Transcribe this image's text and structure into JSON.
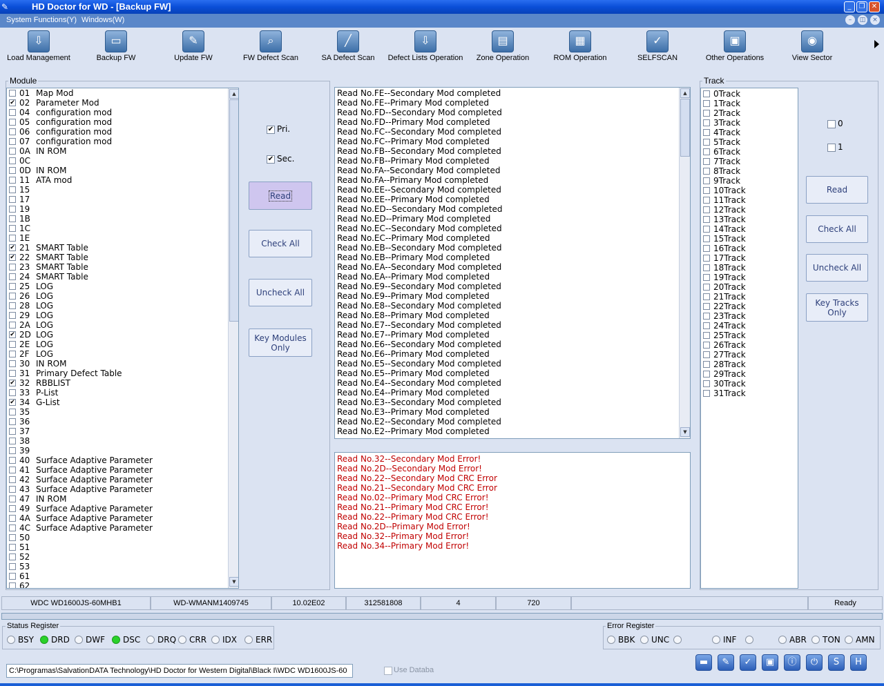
{
  "window": {
    "title": "HD Doctor for WD - [Backup FW]"
  },
  "menu": {
    "items": [
      "System Functions(Y)",
      "Windows(W)"
    ]
  },
  "toolbar": {
    "buttons": [
      {
        "label": "Load Management",
        "icon": "load-management-icon"
      },
      {
        "label": "Backup FW",
        "icon": "floppy-icon"
      },
      {
        "label": "Update FW",
        "icon": "update-icon"
      },
      {
        "label": "FW Defect Scan",
        "icon": "magnifier-icon"
      },
      {
        "label": "SA Defect Scan",
        "icon": "wand-icon"
      },
      {
        "label": "Defect Lists Operation",
        "icon": "defect-list-icon"
      },
      {
        "label": "Zone Operation",
        "icon": "zone-icon"
      },
      {
        "label": "ROM Operation",
        "icon": "chip-icon"
      },
      {
        "label": "SELFSCAN",
        "icon": "checkmark-icon"
      },
      {
        "label": "Other Operations",
        "icon": "document-icon"
      },
      {
        "label": "View Sector",
        "icon": "disk-icon"
      }
    ]
  },
  "module": {
    "title": "Module",
    "items": [
      {
        "code": "01",
        "name": "Map Mod",
        "checked": false
      },
      {
        "code": "02",
        "name": "Parameter Mod",
        "checked": true
      },
      {
        "code": "04",
        "name": "configuration mod",
        "checked": false
      },
      {
        "code": "05",
        "name": "configuration mod",
        "checked": false
      },
      {
        "code": "06",
        "name": "configuration mod",
        "checked": false
      },
      {
        "code": "07",
        "name": "configuration mod",
        "checked": false
      },
      {
        "code": "0A",
        "name": "IN ROM",
        "checked": false
      },
      {
        "code": "0C",
        "name": "",
        "checked": false
      },
      {
        "code": "0D",
        "name": "IN ROM",
        "checked": false
      },
      {
        "code": "11",
        "name": "ATA mod",
        "checked": false
      },
      {
        "code": "15",
        "name": "",
        "checked": false
      },
      {
        "code": "17",
        "name": "",
        "checked": false
      },
      {
        "code": "19",
        "name": "",
        "checked": false
      },
      {
        "code": "1B",
        "name": "",
        "checked": false
      },
      {
        "code": "1C",
        "name": "",
        "checked": false
      },
      {
        "code": "1E",
        "name": "",
        "checked": false
      },
      {
        "code": "21",
        "name": "SMART Table",
        "checked": true
      },
      {
        "code": "22",
        "name": "SMART Table",
        "checked": true
      },
      {
        "code": "23",
        "name": "SMART Table",
        "checked": false
      },
      {
        "code": "24",
        "name": "SMART Table",
        "checked": false
      },
      {
        "code": "25",
        "name": "LOG",
        "checked": false
      },
      {
        "code": "26",
        "name": "LOG",
        "checked": false
      },
      {
        "code": "28",
        "name": "LOG",
        "checked": false
      },
      {
        "code": "29",
        "name": "LOG",
        "checked": false
      },
      {
        "code": "2A",
        "name": "LOG",
        "checked": false
      },
      {
        "code": "2D",
        "name": "LOG",
        "checked": true
      },
      {
        "code": "2E",
        "name": "LOG",
        "checked": false
      },
      {
        "code": "2F",
        "name": "LOG",
        "checked": false
      },
      {
        "code": "30",
        "name": "IN ROM",
        "checked": false
      },
      {
        "code": "31",
        "name": "Primary Defect Table",
        "checked": false
      },
      {
        "code": "32",
        "name": "RBBLIST",
        "checked": true
      },
      {
        "code": "33",
        "name": "P-List",
        "checked": false
      },
      {
        "code": "34",
        "name": "G-List",
        "checked": true
      },
      {
        "code": "35",
        "name": "",
        "checked": false
      },
      {
        "code": "36",
        "name": "",
        "checked": false
      },
      {
        "code": "37",
        "name": "",
        "checked": false
      },
      {
        "code": "38",
        "name": "",
        "checked": false
      },
      {
        "code": "39",
        "name": "",
        "checked": false
      },
      {
        "code": "40",
        "name": "Surface Adaptive Parameter",
        "checked": false
      },
      {
        "code": "41",
        "name": "Surface Adaptive Parameter",
        "checked": false
      },
      {
        "code": "42",
        "name": "Surface Adaptive Parameter",
        "checked": false
      },
      {
        "code": "43",
        "name": "Surface Adaptive Parameter",
        "checked": false
      },
      {
        "code": "47",
        "name": "IN ROM",
        "checked": false
      },
      {
        "code": "49",
        "name": "Surface Adaptive Parameter",
        "checked": false
      },
      {
        "code": "4A",
        "name": "Surface Adaptive Parameter",
        "checked": false
      },
      {
        "code": "4C",
        "name": "Surface Adaptive Parameter",
        "checked": false
      },
      {
        "code": "50",
        "name": "",
        "checked": false
      },
      {
        "code": "51",
        "name": "",
        "checked": false
      },
      {
        "code": "52",
        "name": "",
        "checked": false
      },
      {
        "code": "53",
        "name": "",
        "checked": false
      },
      {
        "code": "61",
        "name": "",
        "checked": false
      },
      {
        "code": "62",
        "name": "",
        "checked": false
      }
    ]
  },
  "controls": {
    "pri_label": "Pri.",
    "pri_checked": true,
    "sec_label": "Sec.",
    "sec_checked": true,
    "read_label": "Read",
    "check_all_label": "Check All",
    "uncheck_all_label": "Uncheck All",
    "key_modules_label": "Key Modules Only"
  },
  "log": {
    "lines": [
      "Read No.FE--Secondary Mod completed",
      "Read No.FE--Primary Mod completed",
      "Read No.FD--Secondary Mod completed",
      "Read No.FD--Primary Mod completed",
      "Read No.FC--Secondary Mod completed",
      "Read No.FC--Primary Mod completed",
      "Read No.FB--Secondary Mod completed",
      "Read No.FB--Primary Mod completed",
      "Read No.FA--Secondary Mod completed",
      "Read No.FA--Primary Mod completed",
      "Read No.EE--Secondary Mod completed",
      "Read No.EE--Primary Mod completed",
      "Read No.ED--Secondary Mod completed",
      "Read No.ED--Primary Mod completed",
      "Read No.EC--Secondary Mod completed",
      "Read No.EC--Primary Mod completed",
      "Read No.EB--Secondary Mod completed",
      "Read No.EB--Primary Mod completed",
      "Read No.EA--Secondary Mod completed",
      "Read No.EA--Primary Mod completed",
      "Read No.E9--Secondary Mod completed",
      "Read No.E9--Primary Mod completed",
      "Read No.E8--Secondary Mod completed",
      "Read No.E8--Primary Mod completed",
      "Read No.E7--Secondary Mod completed",
      "Read No.E7--Primary Mod completed",
      "Read No.E6--Secondary Mod completed",
      "Read No.E6--Primary Mod completed",
      "Read No.E5--Secondary Mod completed",
      "Read No.E5--Primary Mod completed",
      "Read No.E4--Secondary Mod completed",
      "Read No.E4--Primary Mod completed",
      "Read No.E3--Secondary Mod completed",
      "Read No.E3--Primary Mod completed",
      "Read No.E2--Secondary Mod completed",
      "Read No.E2--Primary Mod completed"
    ]
  },
  "errors": {
    "lines": [
      "Read No.32--Secondary Mod Error!",
      "Read No.2D--Secondary Mod Error!",
      "Read No.22--Secondary Mod CRC Error",
      "Read No.21--Secondary Mod CRC Error",
      "Read No.02--Primary Mod CRC Error!",
      "Read No.21--Primary Mod CRC Error!",
      "Read No.22--Primary Mod CRC Error!",
      "Read No.2D--Primary Mod Error!",
      "Read No.32--Primary Mod Error!",
      "Read No.34--Primary Mod Error!"
    ]
  },
  "track": {
    "title": "Track",
    "items": [
      "0Track",
      "1Track",
      "2Track",
      "3Track",
      "4Track",
      "5Track",
      "6Track",
      "7Track",
      "8Track",
      "9Track",
      "10Track",
      "11Track",
      "12Track",
      "13Track",
      "14Track",
      "15Track",
      "16Track",
      "17Track",
      "18Track",
      "19Track",
      "20Track",
      "21Track",
      "22Track",
      "23Track",
      "24Track",
      "25Track",
      "26Track",
      "27Track",
      "28Track",
      "29Track",
      "30Track",
      "31Track"
    ],
    "head0_label": "0",
    "head1_label": "1",
    "read_label": "Read",
    "check_all_label": "Check All",
    "uncheck_all_label": "Uncheck All",
    "key_tracks_label": "Key Tracks Only"
  },
  "status": {
    "model": "WDC WD1600JS-60MHB1",
    "serial": "WD-WMANM1409745",
    "firmware": "10.02E02",
    "lba": "312581808",
    "heads": "4",
    "value720": "720",
    "state": "Ready"
  },
  "status_register": {
    "title": "Status Register",
    "leds": [
      {
        "label": "BSY",
        "on": false
      },
      {
        "label": "DRD",
        "on": true
      },
      {
        "label": "DWF",
        "on": false
      },
      {
        "label": "DSC",
        "on": true
      },
      {
        "label": "DRQ",
        "on": false
      },
      {
        "label": "CRR",
        "on": false
      },
      {
        "label": "IDX",
        "on": false
      },
      {
        "label": "ERR",
        "on": false
      }
    ]
  },
  "error_register": {
    "title": "Error Register",
    "leds": [
      {
        "label": "BBK",
        "on": false
      },
      {
        "label": "UNC",
        "on": false
      },
      {
        "label": "",
        "on": false
      },
      {
        "label": "INF",
        "on": false
      },
      {
        "label": "",
        "on": false
      },
      {
        "label": "ABR",
        "on": false
      },
      {
        "label": "TON",
        "on": false
      },
      {
        "label": "AMN",
        "on": false
      }
    ]
  },
  "footer": {
    "path": "C:\\Programas\\SalvationDATA Technology\\HD Doctor for Western Digital\\Black I\\WDC WD1600JS-60",
    "use_database_label": "Use Databa",
    "icons": [
      "folder-icon",
      "edit-icon",
      "check-icon",
      "save-icon",
      "info-icon",
      "power-icon",
      "s-icon",
      "h-icon"
    ]
  },
  "colors": {
    "error_text": "#c00000",
    "led_on": "#2ad12a",
    "titlebar": "#0a4ed8",
    "menubar": "#5a87c9"
  }
}
